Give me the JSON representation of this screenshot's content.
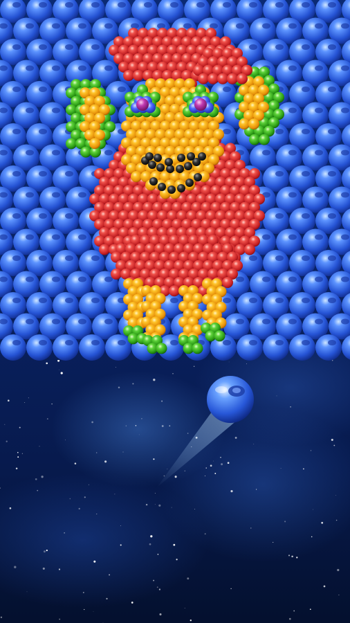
{
  "game": {
    "board": {
      "background_bubble_color": "#2f62e0",
      "rows": 17,
      "cols": 13
    },
    "artwork": {
      "subject": "sheep",
      "colors": {
        "body": "#e23a3a",
        "face": "#f2a818",
        "ears_outer": "#35b81e",
        "eyes": "#3c5bff",
        "pupil": "#b21fa3",
        "mouth": "#222222",
        "legs": "#f1b51a",
        "hooves": "#2ca81a"
      }
    },
    "shooter": {
      "current_bubble_color": "#2f62e0",
      "aim_icon": "aim-trail-icon"
    }
  }
}
